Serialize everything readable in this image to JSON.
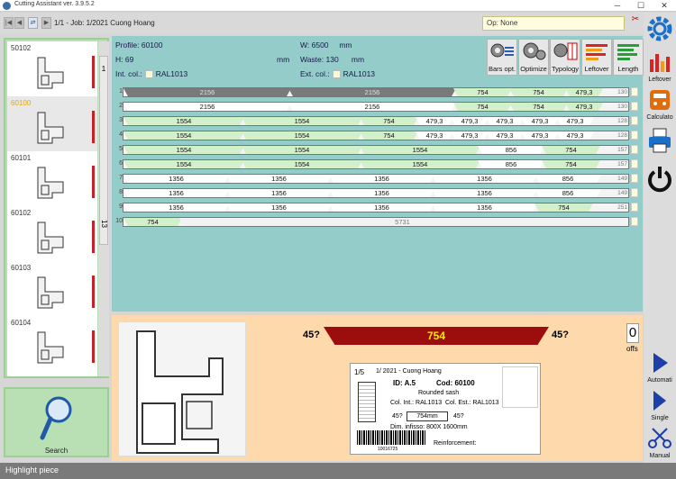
{
  "window": {
    "title": "Cutting Assistant ver. 3.9.5.2"
  },
  "nav": {
    "counter": "1/1",
    "job_label": "- Job:",
    "job_value": "1/2021 Cuong Hoang",
    "op_label": "Op:",
    "op_value": "None"
  },
  "sidebar": {
    "items": [
      {
        "label": "50102",
        "selected": false
      },
      {
        "label": "60100",
        "selected": true
      },
      {
        "label": "60101",
        "selected": false
      },
      {
        "label": "60102",
        "selected": false
      },
      {
        "label": "60103",
        "selected": false
      },
      {
        "label": "60104",
        "selected": false
      }
    ],
    "counter_top": "1",
    "counter_bottom": "13"
  },
  "search": {
    "label": "Search"
  },
  "profile": {
    "profile_label": "Profile:",
    "profile_value": "60100",
    "h_label": "H:",
    "h_value": "69",
    "h_unit": "mm",
    "w_label": "W:",
    "w_value": "6500",
    "w_unit": "mm",
    "waste_label": "Waste:",
    "waste_value": "130",
    "waste_unit": "mm",
    "int_label": "Int. col.:",
    "int_value": "RAL1013",
    "ext_label": "Ext. col.:",
    "ext_value": "RAL1013"
  },
  "tools": [
    "Bars opt.",
    "Optimize",
    "Typology",
    "Leftover",
    "Length"
  ],
  "right_tools": [
    "Leftover",
    "Calculato",
    "Automati",
    "Single",
    "Manual"
  ],
  "bars": [
    {
      "num": "1",
      "end": "130",
      "segs": [
        {
          "v": "2156",
          "w": 186,
          "c": "#7a7a7a",
          "t": "#e0e0e0"
        },
        {
          "v": "2156",
          "w": 186,
          "c": "#7a7a7a",
          "t": "#e0e0e0"
        },
        {
          "v": "754",
          "w": 65,
          "c": "#d2f0c9"
        },
        {
          "v": "754",
          "w": 65,
          "c": "#d2f0c9"
        },
        {
          "v": "479,3",
          "w": 42,
          "c": "#d2f0c9"
        }
      ]
    },
    {
      "num": "2",
      "end": "130",
      "segs": [
        {
          "v": "2156",
          "w": 186,
          "c": "#fff"
        },
        {
          "v": "2156",
          "w": 186,
          "c": "#fff"
        },
        {
          "v": "754",
          "w": 65,
          "c": "#d2f0c9"
        },
        {
          "v": "754",
          "w": 65,
          "c": "#d2f0c9"
        },
        {
          "v": "479,3",
          "w": 42,
          "c": "#d2f0c9"
        }
      ]
    },
    {
      "num": "3",
      "end": "128",
      "segs": [
        {
          "v": "1554",
          "w": 134,
          "c": "#d2f0c9"
        },
        {
          "v": "1554",
          "w": 134,
          "c": "#d2f0c9"
        },
        {
          "v": "754",
          "w": 65,
          "c": "#d2f0c9"
        },
        {
          "v": "479,3",
          "w": 42,
          "c": "#fff"
        },
        {
          "v": "479,3",
          "w": 42,
          "c": "#fff"
        },
        {
          "v": "479,3",
          "w": 42,
          "c": "#fff"
        },
        {
          "v": "479,3",
          "w": 42,
          "c": "#fff"
        },
        {
          "v": "479,3",
          "w": 42,
          "c": "#fff"
        }
      ]
    },
    {
      "num": "4",
      "end": "128",
      "segs": [
        {
          "v": "1554",
          "w": 134,
          "c": "#d2f0c9"
        },
        {
          "v": "1554",
          "w": 134,
          "c": "#d2f0c9"
        },
        {
          "v": "754",
          "w": 65,
          "c": "#d2f0c9"
        },
        {
          "v": "479,3",
          "w": 42,
          "c": "#fff"
        },
        {
          "v": "479,3",
          "w": 42,
          "c": "#fff"
        },
        {
          "v": "479,3",
          "w": 42,
          "c": "#fff"
        },
        {
          "v": "479,3",
          "w": 42,
          "c": "#fff"
        },
        {
          "v": "479,3",
          "w": 42,
          "c": "#fff"
        }
      ]
    },
    {
      "num": "5",
      "end": "157",
      "segs": [
        {
          "v": "1554",
          "w": 134,
          "c": "#d2f0c9"
        },
        {
          "v": "1554",
          "w": 134,
          "c": "#d2f0c9"
        },
        {
          "v": "1554",
          "w": 134,
          "c": "#d2f0c9"
        },
        {
          "v": "856",
          "w": 74,
          "c": "#fff"
        },
        {
          "v": "754",
          "w": 65,
          "c": "#d2f0c9"
        }
      ]
    },
    {
      "num": "6",
      "end": "157",
      "segs": [
        {
          "v": "1554",
          "w": 134,
          "c": "#d2f0c9"
        },
        {
          "v": "1554",
          "w": 134,
          "c": "#d2f0c9"
        },
        {
          "v": "1554",
          "w": 134,
          "c": "#d2f0c9"
        },
        {
          "v": "856",
          "w": 74,
          "c": "#fff"
        },
        {
          "v": "754",
          "w": 65,
          "c": "#d2f0c9"
        }
      ]
    },
    {
      "num": "7",
      "end": "149",
      "segs": [
        {
          "v": "1356",
          "w": 117,
          "c": "#fff"
        },
        {
          "v": "1356",
          "w": 117,
          "c": "#fff"
        },
        {
          "v": "1356",
          "w": 117,
          "c": "#fff"
        },
        {
          "v": "1356",
          "w": 117,
          "c": "#fff"
        },
        {
          "v": "856",
          "w": 74,
          "c": "#fff"
        }
      ]
    },
    {
      "num": "8",
      "end": "149",
      "segs": [
        {
          "v": "1356",
          "w": 117,
          "c": "#fff"
        },
        {
          "v": "1356",
          "w": 117,
          "c": "#fff"
        },
        {
          "v": "1356",
          "w": 117,
          "c": "#fff"
        },
        {
          "v": "1356",
          "w": 117,
          "c": "#fff"
        },
        {
          "v": "856",
          "w": 74,
          "c": "#fff"
        }
      ]
    },
    {
      "num": "9",
      "end": "251",
      "segs": [
        {
          "v": "1356",
          "w": 117,
          "c": "#fff"
        },
        {
          "v": "1356",
          "w": 117,
          "c": "#fff"
        },
        {
          "v": "1356",
          "w": 117,
          "c": "#fff"
        },
        {
          "v": "1356",
          "w": 117,
          "c": "#fff"
        },
        {
          "v": "754",
          "w": 65,
          "c": "#d2f0c9"
        }
      ]
    },
    {
      "num": "10",
      "end": "",
      "segs": [
        {
          "v": "754",
          "w": 65,
          "c": "#d2f0c9"
        },
        {
          "v": "5731",
          "w": 495,
          "c": "#f2f2f2",
          "t": "#777"
        }
      ]
    }
  ],
  "cut": {
    "left_angle": "45?",
    "right_angle": "45?",
    "length": "754",
    "offs_value": "0",
    "offs_label": "offs"
  },
  "label": {
    "index": "1/5",
    "job": "1/ 2021 - Cuong Hoang",
    "id": "ID: A.5",
    "cod": "Cod: 60100",
    "desc": "Rounded sash",
    "col_int": "Col. Int.: RAL1013",
    "col_est": "Col. Est.: RAL1013",
    "angle_left": "45?",
    "length": "754mm",
    "angle_right": "45?",
    "dim_label": "Dim. infisso:",
    "dim_w": "800X",
    "dim_h": "1600mm",
    "reinf": "Reinforcement:",
    "barcode_num": "10016725"
  },
  "status": {
    "text": "Highlight piece"
  }
}
